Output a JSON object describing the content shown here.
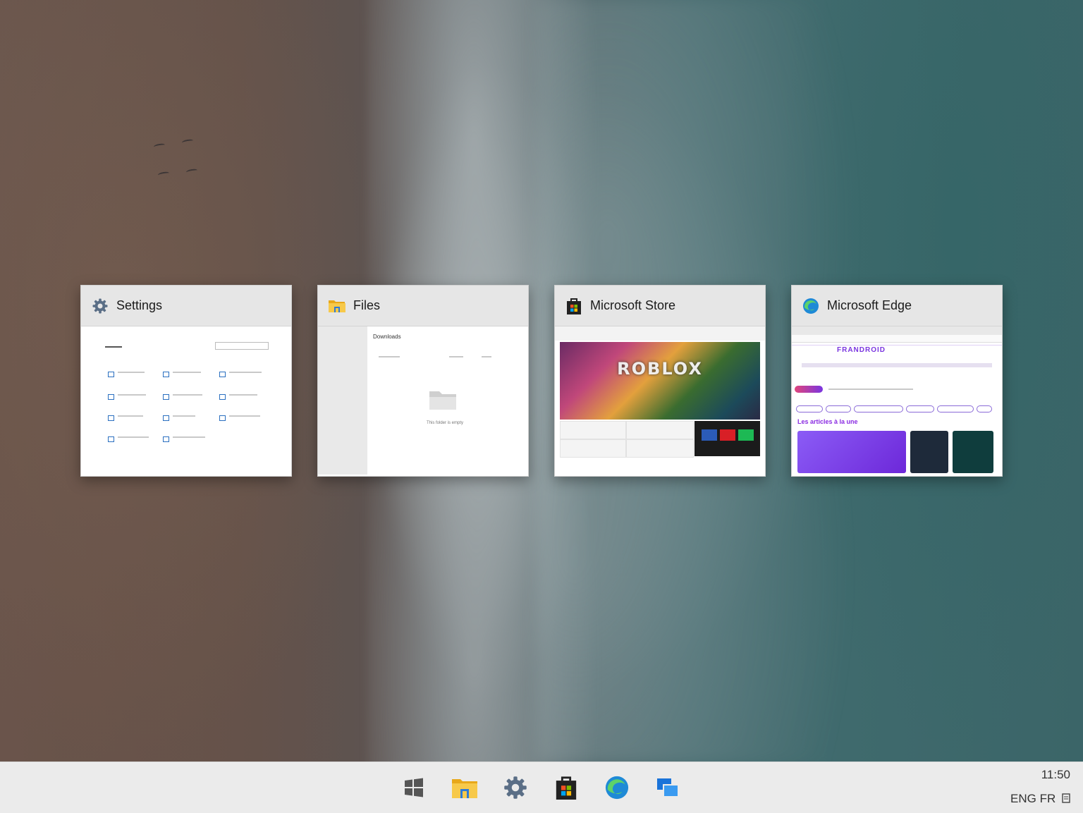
{
  "windows": [
    {
      "title": "Settings",
      "icon": "gear-icon"
    },
    {
      "title": "Files",
      "icon": "folder-icon"
    },
    {
      "title": "Microsoft Store",
      "icon": "store-bag-icon"
    },
    {
      "title": "Microsoft Edge",
      "icon": "edge-icon"
    }
  ],
  "previews": {
    "files_heading": "Downloads",
    "files_empty": "This folder is empty",
    "store_hero": "ROBLOX",
    "edge_brand": "FRANDROID",
    "edge_heading": "Les articles à la une"
  },
  "taskbar": {
    "items": [
      "start-icon",
      "folder-icon",
      "gear-icon",
      "store-bag-icon",
      "edge-icon",
      "task-view-icon"
    ],
    "time": "11:50",
    "language": "ENG FR"
  },
  "colors": {
    "taskbar_bg": "#ebebeb",
    "card_header_bg": "#e6e6e6",
    "edge_accent": "#7a35e0"
  }
}
